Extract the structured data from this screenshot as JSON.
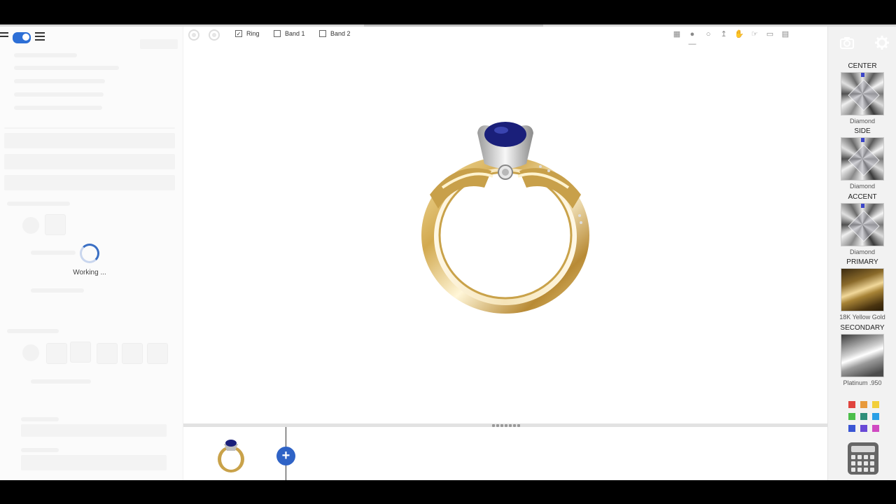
{
  "toolbar": {
    "checkboxes": [
      {
        "label": "Ring",
        "checked": true
      },
      {
        "label": "Band 1",
        "checked": false
      },
      {
        "label": "Band 2",
        "checked": false
      }
    ],
    "tool_icons": [
      "grid-view-icon",
      "orbit-icon",
      "rotate-icon",
      "pan-vertical-icon",
      "hand-icon",
      "grab-icon",
      "screen-icon",
      "portrait-icon"
    ]
  },
  "left_panel": {
    "loading_text": "Working ..."
  },
  "right_panel": {
    "sections": [
      {
        "label": "CENTER",
        "material": "Diamond",
        "kind": "diamond"
      },
      {
        "label": "SIDE",
        "material": "Diamond",
        "kind": "diamond"
      },
      {
        "label": "ACCENT",
        "material": "Diamond",
        "kind": "diamond"
      },
      {
        "label": "PRIMARY",
        "material": "18K Yellow Gold",
        "kind": "gold"
      },
      {
        "label": "SECONDARY",
        "material": "Platinum .950",
        "kind": "platinum"
      }
    ],
    "color_palette": [
      "#e0443e",
      "#e89a3c",
      "#f2cf3a",
      "#4cbe4a",
      "#2f8f7a",
      "#2aa0e6",
      "#3a56d4",
      "#6a4ad6",
      "#d04ac2"
    ]
  },
  "timeline": {
    "add_label": "+"
  },
  "colors": {
    "accent": "#2f63c6",
    "gold": "#d9b45a",
    "sapphire": "#1a1f7a"
  }
}
